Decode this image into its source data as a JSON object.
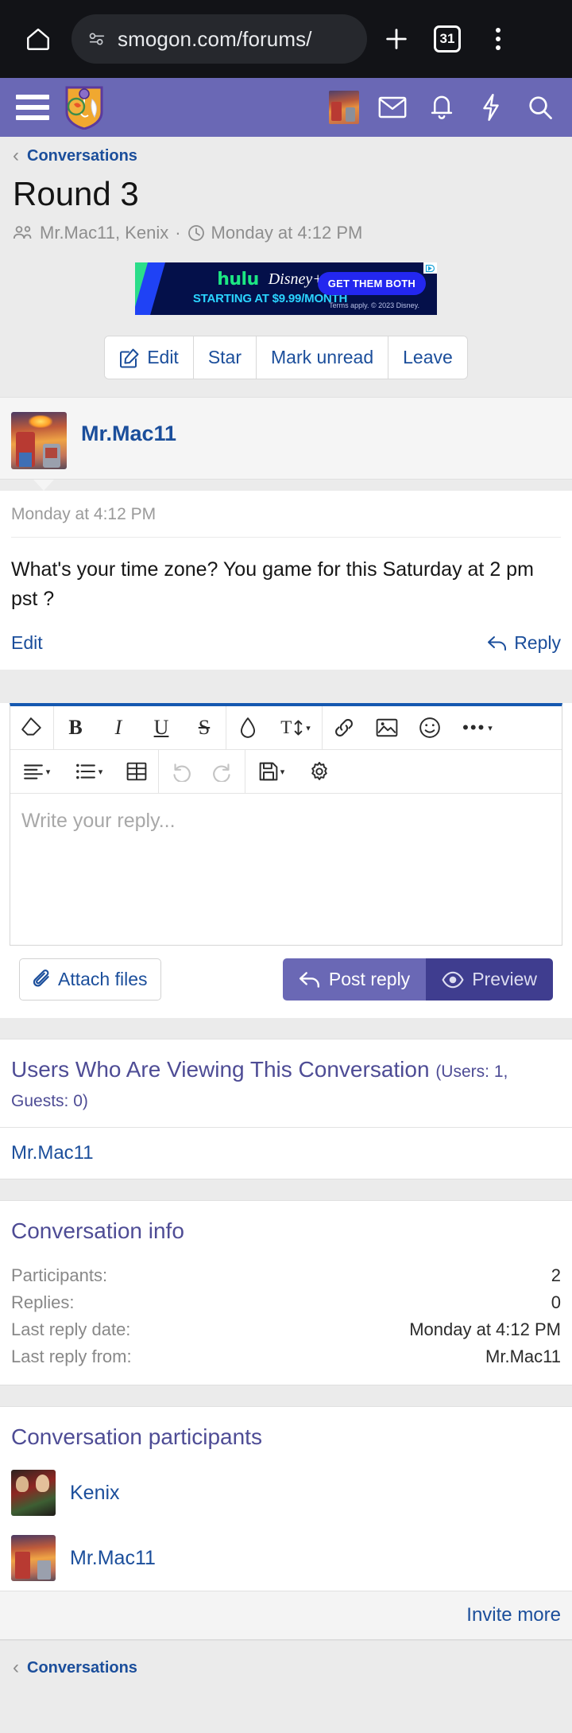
{
  "browser": {
    "url": "smogon.com/forums/",
    "home_icon": "home-icon",
    "site_info_icon": "site-settings-icon",
    "new_tab_icon": "plus-icon",
    "tab_count": "31",
    "menu_icon": "kebab-menu-icon"
  },
  "site_header": {
    "menu_icon": "hamburger-menu-icon",
    "logo_icon": "smogon-shield-logo",
    "avatar_icon": "user-avatar",
    "inbox_icon": "envelope-icon",
    "alerts_icon": "bell-icon",
    "bolt_icon": "lightning-bolt-icon",
    "search_icon": "search-icon"
  },
  "breadcrumb": {
    "back_icon": "chevron-left-icon",
    "label": "Conversations"
  },
  "conversation": {
    "title": "Round 3",
    "participants_icon": "people-icon",
    "participants_text": "Mr.Mac11, Kenix",
    "separator": "·",
    "clock_icon": "clock-icon",
    "date": "Monday at 4:12 PM"
  },
  "ad": {
    "hulu": "hulu",
    "disney": "Disney+",
    "subtitle": "STARTING AT $9.99/MONTH",
    "cta": "GET THEM BOTH",
    "terms": "Terms apply. © 2023 Disney.",
    "adchoices_icon": "adchoices-icon"
  },
  "actions": [
    {
      "label": "Edit",
      "icon": "pencil-square-icon"
    },
    {
      "label": "Star",
      "icon": ""
    },
    {
      "label": "Mark unread",
      "icon": ""
    },
    {
      "label": "Leave",
      "icon": ""
    }
  ],
  "message": {
    "author": "Mr.Mac11",
    "avatar_icon": "user-avatar",
    "date": "Monday at 4:12 PM",
    "text": "What's your time zone? You game for this Saturday at 2 pm pst ?",
    "edit_label": "Edit",
    "reply_label": "Reply",
    "reply_icon": "reply-arrow-icon"
  },
  "editor": {
    "placeholder": "Write your reply...",
    "toolbar_row1": [
      {
        "icon": "remove-formatting-icon",
        "glyph": ""
      },
      {
        "icon": "bold-icon",
        "glyph": "B"
      },
      {
        "icon": "italic-icon",
        "glyph": "I"
      },
      {
        "icon": "underline-icon",
        "glyph": "U"
      },
      {
        "icon": "strikethrough-icon",
        "glyph": "S"
      },
      {
        "icon": "text-color-icon",
        "glyph": ""
      },
      {
        "icon": "font-size-icon",
        "glyph": "T"
      },
      {
        "icon": "link-icon",
        "glyph": ""
      },
      {
        "icon": "image-icon",
        "glyph": ""
      },
      {
        "icon": "smiley-icon",
        "glyph": ""
      },
      {
        "icon": "more-options-icon",
        "glyph": ""
      }
    ],
    "toolbar_row2": [
      {
        "icon": "align-text-icon",
        "glyph": ""
      },
      {
        "icon": "bullet-list-icon",
        "glyph": ""
      },
      {
        "icon": "table-icon",
        "glyph": ""
      },
      {
        "icon": "undo-icon",
        "glyph": ""
      },
      {
        "icon": "redo-icon",
        "glyph": ""
      },
      {
        "icon": "draft-save-icon",
        "glyph": ""
      },
      {
        "icon": "settings-gear-icon",
        "glyph": ""
      }
    ],
    "attach_label": "Attach files",
    "attach_icon": "paperclip-icon",
    "post_label": "Post reply",
    "post_icon": "reply-arrow-icon",
    "preview_label": "Preview",
    "preview_icon": "eye-icon"
  },
  "viewing": {
    "title": "Users Who Are Viewing This Conversation",
    "counts": "(Users: 1, Guests: 0)",
    "users": [
      "Mr.Mac11"
    ]
  },
  "info": {
    "title": "Conversation info",
    "rows": [
      {
        "label": "Participants:",
        "value": "2",
        "is_link": false
      },
      {
        "label": "Replies:",
        "value": "0",
        "is_link": false
      },
      {
        "label": "Last reply date:",
        "value": "Monday at 4:12 PM",
        "is_link": false
      },
      {
        "label": "Last reply from:",
        "value": "Mr.Mac11",
        "is_link": true
      }
    ]
  },
  "participants": {
    "title": "Conversation participants",
    "list": [
      {
        "name": "Kenix",
        "avatar": "kenix-avatar"
      },
      {
        "name": "Mr.Mac11",
        "avatar": "mrmac11-avatar"
      }
    ],
    "invite_label": "Invite more"
  },
  "footer_breadcrumb": {
    "back_icon": "chevron-left-icon",
    "label": "Conversations"
  },
  "colors": {
    "brand_purple": "#6a68b5",
    "link_blue": "#1b4e9b",
    "heading_purple": "#4e4c95",
    "editor_accent": "#1558b0"
  }
}
